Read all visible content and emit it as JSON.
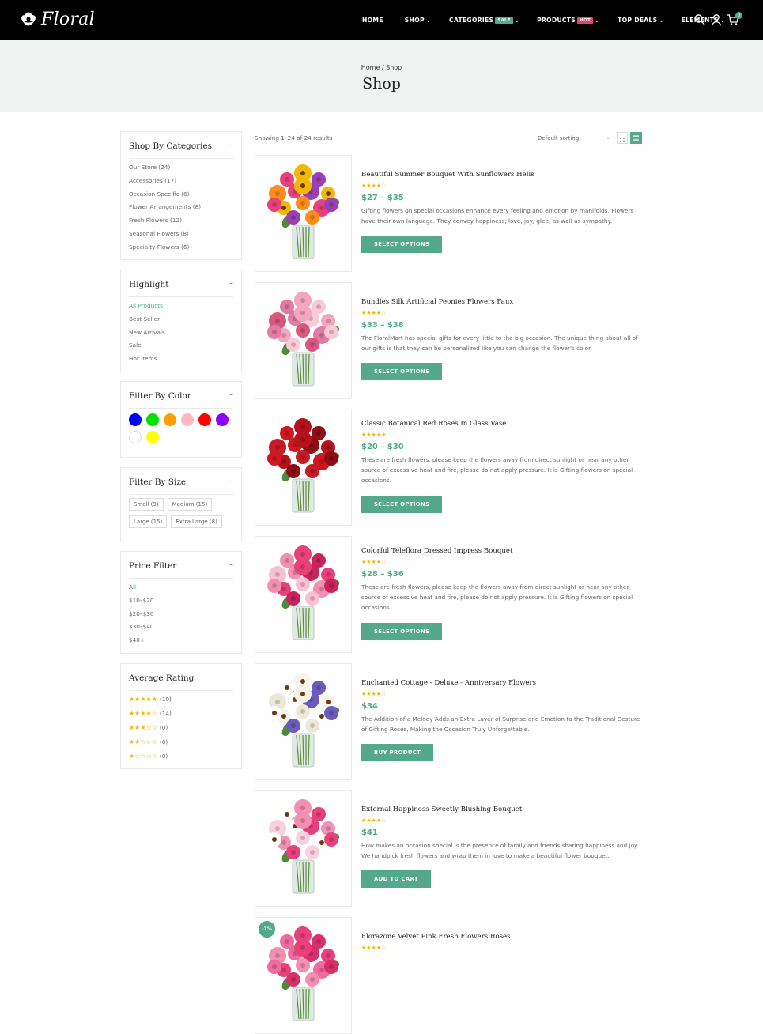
{
  "brand": {
    "name": "Floral",
    "accent": "#54a88c"
  },
  "nav": [
    {
      "label": "HOME"
    },
    {
      "label": "SHOP",
      "chevron": "⌄"
    },
    {
      "label": "CATEGORIES",
      "badge": "SALE",
      "badge_color": "#54a88c",
      "chevron": "⌄"
    },
    {
      "label": "PRODUCTS",
      "badge": "HOT",
      "badge_color": "#e8407a",
      "chevron": "⌄"
    },
    {
      "label": "TOP DEALS",
      "chevron": "⌄"
    },
    {
      "label": "ELEMENTS",
      "chevron": "⌄"
    }
  ],
  "header_icons": [
    "search-icon",
    "user-icon",
    "cart-icon"
  ],
  "cart_count": "0",
  "hero": {
    "breadcrumb": "Home / Shop",
    "title": "Shop"
  },
  "sidebar": {
    "categories": {
      "title": "Shop By Categories",
      "toggle": "–",
      "items": [
        "Our Store (24)",
        "Accessories (17)",
        "Occasion Specific (6)",
        "Flower Arrangements (8)",
        "Fresh Flowers (12)",
        "Seasonal Flowers (8)",
        "Specialty Flowers (6)"
      ]
    },
    "highlight": {
      "title": "Highlight",
      "toggle": "–",
      "items": [
        "All Products",
        "Best Seller",
        "New Arrivals",
        "Sale",
        "Hot Items"
      ],
      "active": 0
    },
    "color": {
      "title": "Filter By Color",
      "toggle": "–",
      "swatches": [
        "#0000ff",
        "#00e000",
        "#ffa000",
        "#ffb6c1",
        "#ff0000",
        "#8b00ff",
        "#ffffff",
        "#ffff00"
      ]
    },
    "size": {
      "title": "Filter By Size",
      "toggle": "–",
      "items": [
        "Small (9)",
        "Medium (15)",
        "Large (15)",
        "Extra Large (8)"
      ]
    },
    "price": {
      "title": "Price Filter",
      "toggle": "–",
      "items": [
        "All",
        "$10–$20",
        "$20–$30",
        "$30–$40",
        "$40+"
      ],
      "active": 0
    },
    "rating": {
      "title": "Average Rating",
      "toggle": "–",
      "rows": [
        {
          "stars": "★★★★★",
          "count": "(10)"
        },
        {
          "stars": "★★★★☆",
          "count": "(14)"
        },
        {
          "stars": "★★★☆☆",
          "count": "(0)"
        },
        {
          "stars": "★★☆☆☆",
          "count": "(0)"
        },
        {
          "stars": "★☆☆☆☆",
          "count": "(0)"
        }
      ]
    }
  },
  "toolbar": {
    "result_count": "Showing 1–24 of 24 results",
    "sort_label": "Default sorting",
    "sort_chevron": "⌄"
  },
  "products": [
    {
      "title": "Beautiful Summer Bouquet With Sunflowers Helis",
      "stars": "★★★★☆",
      "price": "$27 – $35",
      "desc": "Gifting flowers on special occasions enhance every feeling and emotion by manifolds. Flowers have their own language. They convey happiness, love, joy, glee, as well as sympathy.",
      "button": "SELECT OPTIONS",
      "palette": [
        "#f5b800",
        "#e8407a",
        "#9b3fb5",
        "#ff8c1a"
      ],
      "badge": ""
    },
    {
      "title": "Bundles Silk Artificial Peonies Flowers Faux",
      "stars": "★★★★☆",
      "price": "$33 – $38",
      "desc": "The FloralMart has special gifts for every little to the big occasion. The unique thing about all of our gifts is that they can be personalized like you can change the flower's color.",
      "button": "SELECT OPTIONS",
      "palette": [
        "#f4a6c0",
        "#e27aa3",
        "#f9c9d8",
        "#d9587f"
      ],
      "badge": ""
    },
    {
      "title": "Classic Botanical Red Roses In Glass Vase",
      "stars": "★★★★★",
      "price": "$20 – $30",
      "desc": "These are fresh flowers, please keep the flowers away from direct sunlight or near any other source of excessive heat and fire, please do not apply pressure. It is Gifting flowers on special occasions.",
      "button": "SELECT OPTIONS",
      "palette": [
        "#b5121b",
        "#d0161f",
        "#8f0d14",
        "#c41c24"
      ],
      "badge": ""
    },
    {
      "title": "Colorful Teleflora Dressed Impress Bouquet",
      "stars": "★★★★☆",
      "price": "$28 – $36",
      "desc": "These are fresh flowers, please keep the flowers away from direct sunlight or near any other source of excessive heat and fire, please do not apply pressure. It is Gifting flowers on special occasions.",
      "button": "SELECT OPTIONS",
      "palette": [
        "#e8407a",
        "#f38fb0",
        "#c7245c",
        "#f9c0d3"
      ],
      "badge": ""
    },
    {
      "title": "Enchanted Cottage - Deluxe - Anniversary Flowers",
      "stars": "★★★★☆",
      "price": "$34",
      "desc": "The Addition of a Melody Adds an Extra Layer of Surprise and Emotion to the Traditional Gesture of Gifting Roses, Making the Occasion Truly Unforgettable.",
      "button": "BUY PRODUCT",
      "palette": [
        "#f5f3ea",
        "#ffffff",
        "#6b5bbf",
        "#ece8d6"
      ],
      "badge": ""
    },
    {
      "title": "External Happiness Sweetly Blushing Bouquet",
      "stars": "★★★★☆",
      "price": "$41",
      "desc": "How makes an occasion special is the presence of family and friends sharing happiness and joy. We handpick fresh flowers and wrap them in love to make a beautiful flower bouquet.",
      "button": "ADD TO CART",
      "palette": [
        "#f38fb0",
        "#ffffff",
        "#e8407a",
        "#fbd0de"
      ],
      "badge": ""
    },
    {
      "title": "Florazone Velvet Pink Fresh Flowers Roses",
      "stars": "★★★★☆",
      "price": "",
      "desc": "",
      "button": "",
      "palette": [
        "#e8407a",
        "#f06aa0",
        "#d8306a",
        "#f38fb0"
      ],
      "badge": "-7%"
    }
  ]
}
